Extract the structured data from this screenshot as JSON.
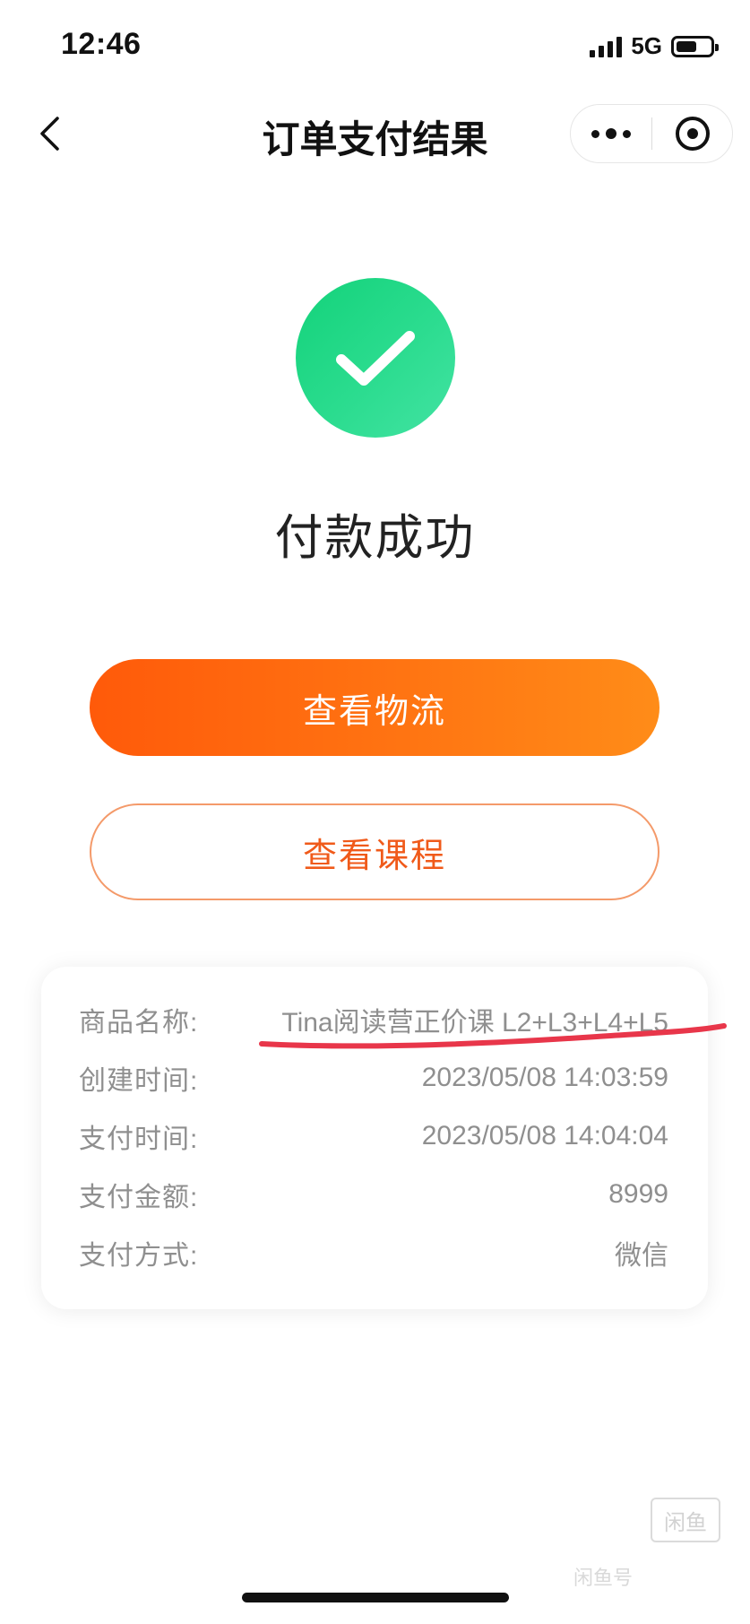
{
  "status_bar": {
    "time": "12:46",
    "network": "5G",
    "battery_level": 0.62
  },
  "nav": {
    "title": "订单支付结果"
  },
  "icons": {
    "back": "chevron-left-icon",
    "more": "more-dots-icon",
    "close": "target-close-icon",
    "success": "checkmark-circle-icon"
  },
  "result": {
    "message": "付款成功"
  },
  "buttons": {
    "logistics": "查看物流",
    "course": "查看课程"
  },
  "order": {
    "rows": [
      {
        "label": "商品名称:",
        "value": "Tina阅读营正价课 L2+L3+L4+L5"
      },
      {
        "label": "创建时间:",
        "value": "2023/05/08 14:03:59"
      },
      {
        "label": "支付时间:",
        "value": "2023/05/08 14:04:04"
      },
      {
        "label": "支付金额:",
        "value": "8999"
      },
      {
        "label": "支付方式:",
        "value": "微信"
      }
    ]
  },
  "watermark": {
    "logo": "闲鱼",
    "text": "闲鱼号"
  },
  "colors": {
    "success_green": "#1ed47e",
    "accent_orange": "#ff6a10",
    "course_text": "#f05a1a",
    "annotation_red": "#e8364a",
    "label_gray": "#8f8f8f"
  }
}
